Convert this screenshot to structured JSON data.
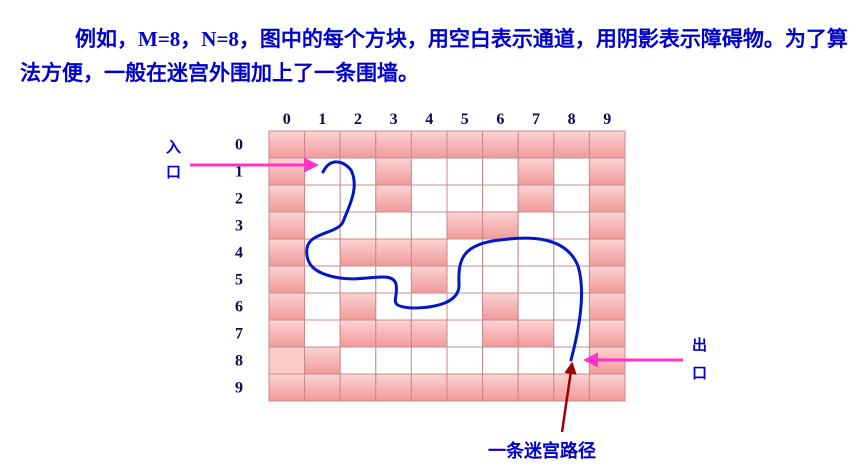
{
  "description": {
    "part1": "例如，",
    "m_eq": "M=8",
    "part2": "，",
    "n_eq": "N=8",
    "part3": "，图中的每个方块，用空白表示通道，用阴影表示障碍物。为了算法方便，一般在迷宫外围加上了一条围墙。"
  },
  "maze": {
    "col_labels": [
      "0",
      "1",
      "2",
      "3",
      "4",
      "5",
      "6",
      "7",
      "8",
      "9"
    ],
    "row_labels": [
      "0",
      "1",
      "2",
      "3",
      "4",
      "5",
      "6",
      "7",
      "8",
      "9"
    ],
    "grid": [
      "1111111111",
      "1001000101",
      "1001000101",
      "1000011001",
      "1011100001",
      "1000100001",
      "1010001001",
      "1011101101",
      "2100000001",
      "1111111111"
    ],
    "legend": {
      "0": "通道",
      "1": "障碍物",
      "2": "围墙"
    },
    "colors": {
      "wall": "#f5a8a8",
      "pale_wall": "#f8cdc8",
      "open": "#ffffff",
      "grid_line": "#c98a8a",
      "path": "#0018c8",
      "arrow": "#ff33cc",
      "pointer": "#a00000"
    }
  },
  "entrance_label": "入口",
  "exit_label": "出口",
  "path_caption": "一条迷宫路径"
}
